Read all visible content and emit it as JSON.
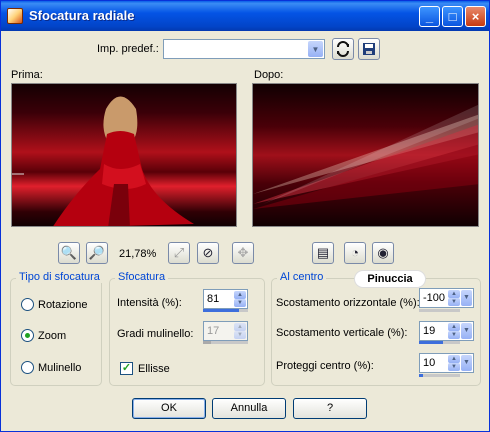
{
  "window": {
    "title": "Sfocatura radiale"
  },
  "presets": {
    "label": "Imp. predef.:",
    "value": ""
  },
  "previews": {
    "before_label": "Prima:",
    "after_label": "Dopo:"
  },
  "zoom": {
    "level": "21,78%"
  },
  "blur_type": {
    "title": "Tipo di sfocatura",
    "options": [
      {
        "label": "Rotazione",
        "selected": false
      },
      {
        "label": "Zoom",
        "selected": true
      },
      {
        "label": "Mulinello",
        "selected": false
      }
    ]
  },
  "blur": {
    "title": "Sfocatura",
    "intensity_label": "Intensità (%):",
    "intensity_value": "81",
    "intensity_fraction": 0.81,
    "twist_label": "Gradi mulinello:",
    "twist_value": "17",
    "ellipse_label": "Ellisse",
    "ellipse_checked": true
  },
  "center": {
    "title": "Al centro",
    "h_offset_label": "Scostamento orizzontale (%):",
    "h_offset_value": "-100",
    "v_offset_label": "Scostamento verticale (%):",
    "v_offset_value": "19",
    "protect_label": "Proteggi centro (%):",
    "protect_value": "10"
  },
  "watermark": "Pinuccia",
  "buttons": {
    "ok": "OK",
    "cancel": "Annulla",
    "help": "?"
  },
  "colors": {
    "title_bar": "#0454e5",
    "dialog_bg": "#ece9d8",
    "group_title": "#0046d5",
    "preview_red": "#b0101a"
  },
  "icons": [
    "app-icon",
    "minimize-icon",
    "maximize-icon",
    "close-icon",
    "load-preset-icon",
    "save-preset-icon",
    "zoom-out-icon",
    "zoom-in-icon",
    "fit-icon",
    "zoom-reset-icon",
    "pan-icon",
    "preview-toggle-icon",
    "proof-icon",
    "eye-icon"
  ]
}
